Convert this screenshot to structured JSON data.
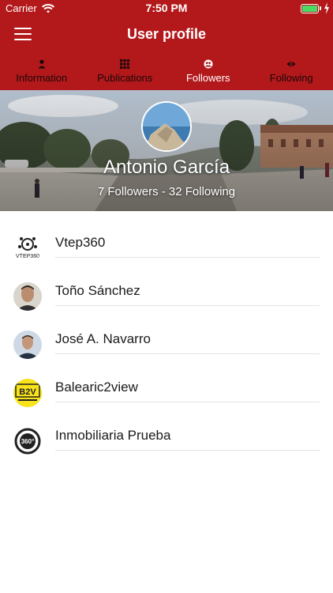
{
  "status_bar": {
    "carrier": "Carrier",
    "time": "7:50 PM"
  },
  "nav": {
    "title": "User profile"
  },
  "tabs": [
    {
      "label": "Information",
      "icon": "person-icon",
      "active": false
    },
    {
      "label": "Publications",
      "icon": "grid-icon",
      "active": false
    },
    {
      "label": "Followers",
      "icon": "followers-icon",
      "active": true
    },
    {
      "label": "Following",
      "icon": "eye-icon",
      "active": false
    }
  ],
  "profile": {
    "name": "Antonio García",
    "stats": "7 Followers - 32 Following"
  },
  "followers": [
    {
      "name": "Vtep360",
      "avatar": "vtep360-logo"
    },
    {
      "name": "Toño Sánchez",
      "avatar": "person-photo"
    },
    {
      "name": "José A. Navarro",
      "avatar": "person-photo"
    },
    {
      "name": "Balearic2view",
      "avatar": "b2v-logo"
    },
    {
      "name": "Inmobiliaria Prueba",
      "avatar": "360-logo"
    }
  ],
  "colors": {
    "brand": "#b3191b",
    "active_tab": "#ffffff",
    "inactive_tab": "#1a0808"
  }
}
